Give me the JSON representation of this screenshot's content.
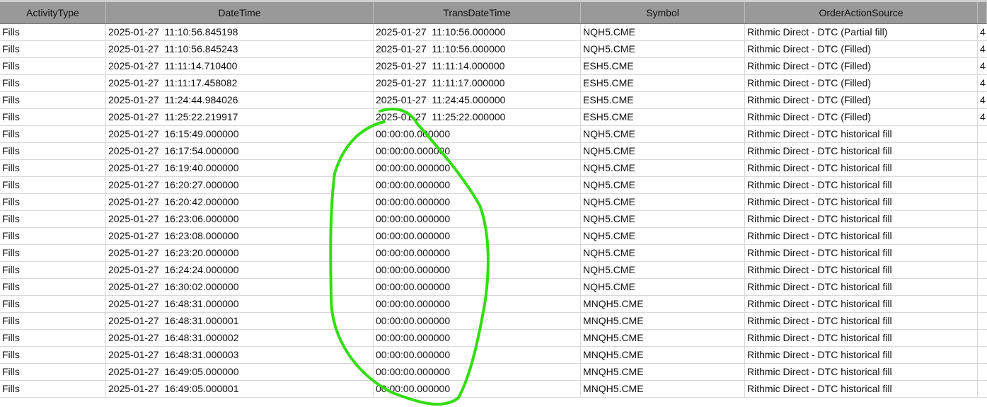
{
  "table": {
    "headers": [
      "ActivityType",
      "DateTime",
      "TransDateTime",
      "Symbol",
      "OrderActionSource",
      ""
    ],
    "rows": [
      [
        "Fills",
        "2025-01-27  11:10:56.845198",
        "2025-01-27  11:10:56.000000",
        "NQH5.CME",
        "Rithmic Direct - DTC (Partial fill)",
        "4"
      ],
      [
        "Fills",
        "2025-01-27  11:10:56.845243",
        "2025-01-27  11:10:56.000000",
        "NQH5.CME",
        "Rithmic Direct - DTC (Filled)",
        "4"
      ],
      [
        "Fills",
        "2025-01-27  11:11:14.710400",
        "2025-01-27  11:11:14.000000",
        "ESH5.CME",
        "Rithmic Direct - DTC (Filled)",
        "4"
      ],
      [
        "Fills",
        "2025-01-27  11:11:17.458082",
        "2025-01-27  11:11:17.000000",
        "ESH5.CME",
        "Rithmic Direct - DTC (Filled)",
        "4"
      ],
      [
        "Fills",
        "2025-01-27  11:24:44.984026",
        "2025-01-27  11:24:45.000000",
        "ESH5.CME",
        "Rithmic Direct - DTC (Filled)",
        "4"
      ],
      [
        "Fills",
        "2025-01-27  11:25:22.219917",
        "2025-01-27  11:25:22.000000",
        "ESH5.CME",
        "Rithmic Direct - DTC (Filled)",
        "4"
      ],
      [
        "Fills",
        "2025-01-27  16:15:49.000000",
        "00:00:00.000000",
        "NQH5.CME",
        "Rithmic Direct - DTC historical fill",
        ""
      ],
      [
        "Fills",
        "2025-01-27  16:17:54.000000",
        "00:00:00.000000",
        "NQH5.CME",
        "Rithmic Direct - DTC historical fill",
        ""
      ],
      [
        "Fills",
        "2025-01-27  16:19:40.000000",
        "00:00:00.000000",
        "NQH5.CME",
        "Rithmic Direct - DTC historical fill",
        ""
      ],
      [
        "Fills",
        "2025-01-27  16:20:27.000000",
        "00:00:00.000000",
        "NQH5.CME",
        "Rithmic Direct - DTC historical fill",
        ""
      ],
      [
        "Fills",
        "2025-01-27  16:20:42.000000",
        "00:00:00.000000",
        "NQH5.CME",
        "Rithmic Direct - DTC historical fill",
        ""
      ],
      [
        "Fills",
        "2025-01-27  16:23:06.000000",
        "00:00:00.000000",
        "NQH5.CME",
        "Rithmic Direct - DTC historical fill",
        ""
      ],
      [
        "Fills",
        "2025-01-27  16:23:08.000000",
        "00:00:00.000000",
        "NQH5.CME",
        "Rithmic Direct - DTC historical fill",
        ""
      ],
      [
        "Fills",
        "2025-01-27  16:23:20.000000",
        "00:00:00.000000",
        "NQH5.CME",
        "Rithmic Direct - DTC historical fill",
        ""
      ],
      [
        "Fills",
        "2025-01-27  16:24:24.000000",
        "00:00:00.000000",
        "NQH5.CME",
        "Rithmic Direct - DTC historical fill",
        ""
      ],
      [
        "Fills",
        "2025-01-27  16:30:02.000000",
        "00:00:00.000000",
        "NQH5.CME",
        "Rithmic Direct - DTC historical fill",
        ""
      ],
      [
        "Fills",
        "2025-01-27  16:48:31.000000",
        "00:00:00.000000",
        "MNQH5.CME",
        "Rithmic Direct - DTC historical fill",
        ""
      ],
      [
        "Fills",
        "2025-01-27  16:48:31.000001",
        "00:00:00.000000",
        "MNQH5.CME",
        "Rithmic Direct - DTC historical fill",
        ""
      ],
      [
        "Fills",
        "2025-01-27  16:48:31.000002",
        "00:00:00.000000",
        "MNQH5.CME",
        "Rithmic Direct - DTC historical fill",
        ""
      ],
      [
        "Fills",
        "2025-01-27  16:48:31.000003",
        "00:00:00.000000",
        "MNQH5.CME",
        "Rithmic Direct - DTC historical fill",
        ""
      ],
      [
        "Fills",
        "2025-01-27  16:49:05.000000",
        "00:00:00.000000",
        "MNQH5.CME",
        "Rithmic Direct - DTC historical fill",
        ""
      ],
      [
        "Fills",
        "2025-01-27  16:49:05.000001",
        "00:00:00.000000",
        "MNQH5.CME",
        "Rithmic Direct - DTC historical fill",
        ""
      ]
    ]
  },
  "colors": {
    "header_bg": "#999999",
    "annotation": "#33dd11"
  }
}
